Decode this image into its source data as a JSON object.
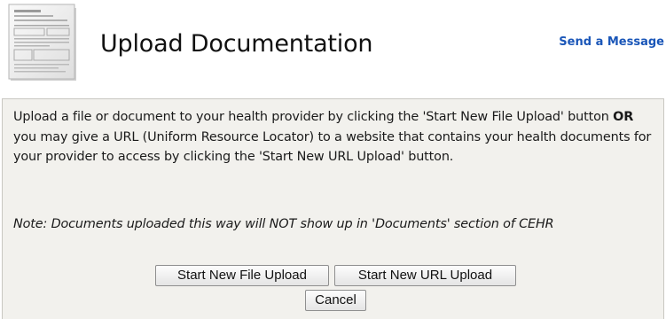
{
  "header": {
    "icon": "document-thumbnail-icon",
    "title": "Upload Documentation",
    "send_message_label": "Send a Message"
  },
  "panel": {
    "intro_part1": "Upload a file or document to your health provider by clicking the 'Start New File Upload' button ",
    "intro_bold": "OR",
    "intro_part2": " you may give a URL (Uniform Resource Locator) to a website that contains your health documents for your provider to access by clicking the 'Start New URL Upload' button.",
    "note": "Note: Documents uploaded this way will NOT show up in 'Documents' section of CEHR"
  },
  "buttons": {
    "start_file": "Start New File Upload",
    "start_url": "Start New URL Upload",
    "cancel": "Cancel"
  },
  "colors": {
    "link": "#1a56b8",
    "panel_background": "#f2f1ed",
    "panel_border": "#c9c7c1"
  }
}
